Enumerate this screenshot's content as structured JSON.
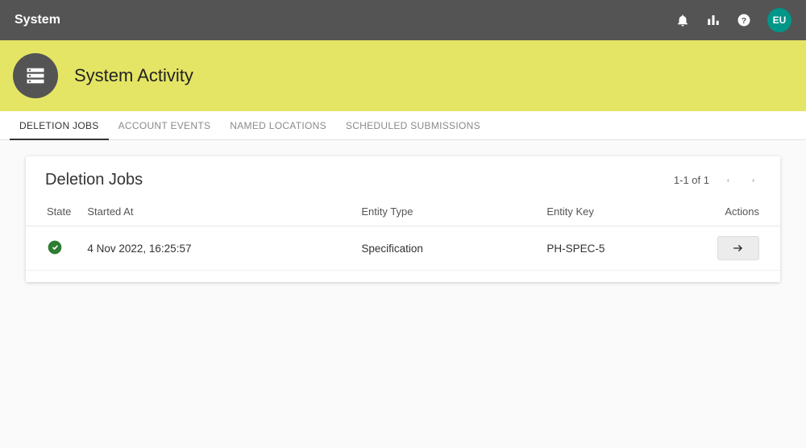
{
  "topbar": {
    "brand": "System",
    "avatar_initials": "EU"
  },
  "header": {
    "title": "System Activity"
  },
  "tabs": [
    {
      "label": "DELETION JOBS",
      "active": true
    },
    {
      "label": "ACCOUNT EVENTS",
      "active": false
    },
    {
      "label": "NAMED LOCATIONS",
      "active": false
    },
    {
      "label": "SCHEDULED SUBMISSIONS",
      "active": false
    }
  ],
  "card": {
    "title": "Deletion Jobs",
    "pagination_label": "1-1 of 1",
    "columns": {
      "state": "State",
      "started_at": "Started At",
      "entity_type": "Entity Type",
      "entity_key": "Entity Key",
      "actions": "Actions"
    },
    "rows": [
      {
        "state": "success",
        "started_at": "4 Nov 2022, 16:25:57",
        "entity_type": "Specification",
        "entity_key": "PH-SPEC-5"
      }
    ]
  }
}
